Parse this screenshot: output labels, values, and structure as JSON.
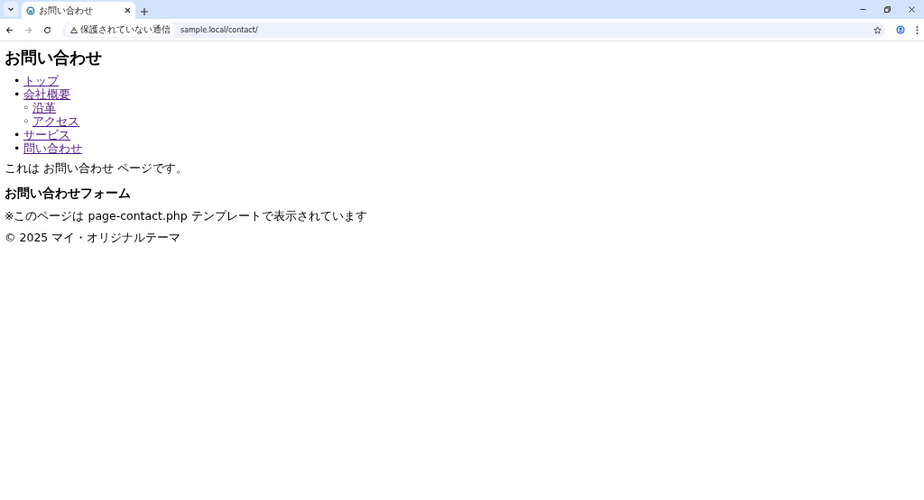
{
  "browser": {
    "tabs": [
      {
        "title": "お問い合わせ",
        "selected": true
      }
    ],
    "security_label": "保護されていない通信",
    "url": "sample.local/contact/"
  },
  "page": {
    "title": "お問い合わせ",
    "nav": [
      {
        "marker": "•",
        "label": "トップ",
        "visited": true
      },
      {
        "marker": "•",
        "label": "会社概要",
        "visited": true,
        "children": [
          {
            "marker": "◦",
            "label": "沿革",
            "visited": true
          },
          {
            "marker": "◦",
            "label": "アクセス",
            "visited": true
          }
        ]
      },
      {
        "marker": "•",
        "label": "サービス",
        "visited": true
      },
      {
        "marker": "•",
        "label": "問い合わせ",
        "visited": true
      }
    ],
    "intro": "これは お問い合わせ ページです。",
    "section_title": "お問い合わせフォーム",
    "note": "※このページは page-contact.php テンプレートで表示されています",
    "footer": "© 2025 マイ・オリジナルテーマ"
  }
}
